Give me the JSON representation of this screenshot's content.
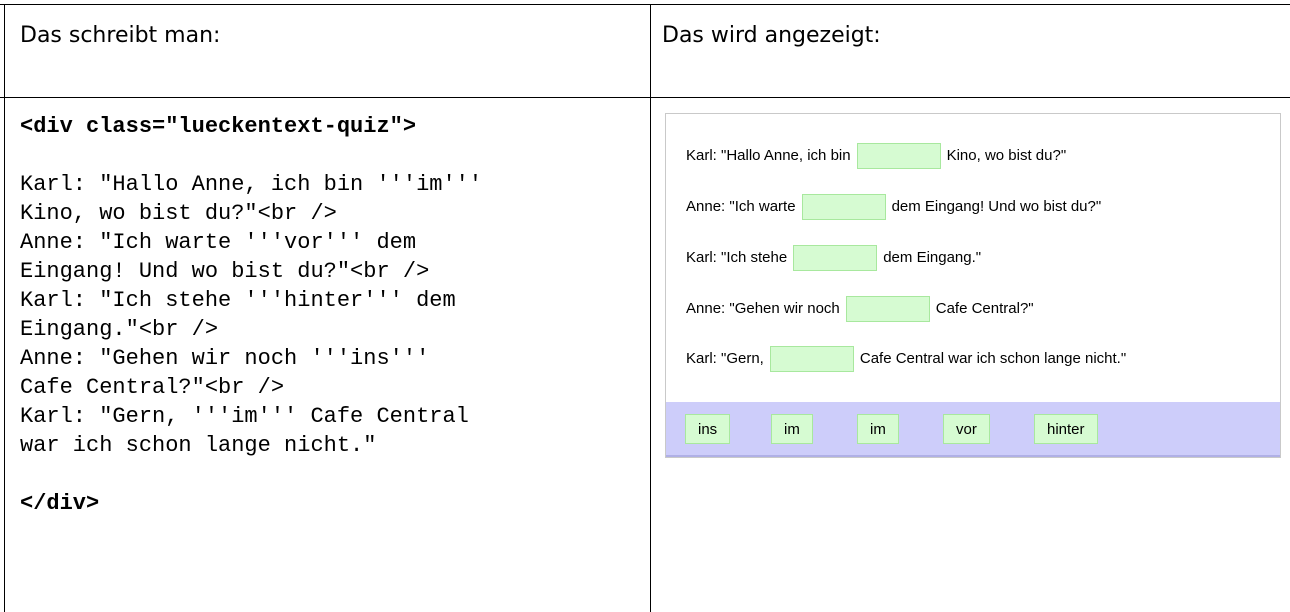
{
  "headers": {
    "left": "Das schreibt man:",
    "right": "Das wird angezeigt:"
  },
  "code": {
    "open_tag": "<div class=\"lueckentext-quiz\">",
    "lines": [
      "Karl: \"Hallo Anne, ich bin '''im'''",
      "Kino, wo bist du?\"<br />",
      "Anne: \"Ich warte '''vor''' dem",
      "Eingang! Und wo bist du?\"<br />",
      "Karl: \"Ich stehe '''hinter''' dem",
      "Eingang.\"<br />",
      "Anne: \"Gehen wir noch '''ins'''",
      "Cafe Central?\"<br />",
      "Karl: \"Gern, '''im''' Cafe Central",
      "war ich schon lange nicht.\""
    ],
    "close_tag": "</div>"
  },
  "preview": {
    "sentences": [
      {
        "before": "Karl: \"Hallo Anne, ich bin",
        "after": "Kino, wo bist du?\""
      },
      {
        "before": "Anne: \"Ich warte",
        "after": "dem Eingang! Und wo bist du?\""
      },
      {
        "before": "Karl: \"Ich stehe",
        "after": "dem Eingang.\""
      },
      {
        "before": "Anne: \"Gehen wir noch",
        "after": "Cafe Central?\""
      },
      {
        "before": "Karl: \"Gern,",
        "after": "Cafe Central war ich schon lange nicht.\""
      }
    ],
    "words": [
      "ins",
      "im",
      "im",
      "vor",
      "hinter"
    ]
  },
  "colors": {
    "gap_fill": "#d6fbd2",
    "gap_border": "#a8e89e",
    "word_bar": "#cdcdfa"
  }
}
